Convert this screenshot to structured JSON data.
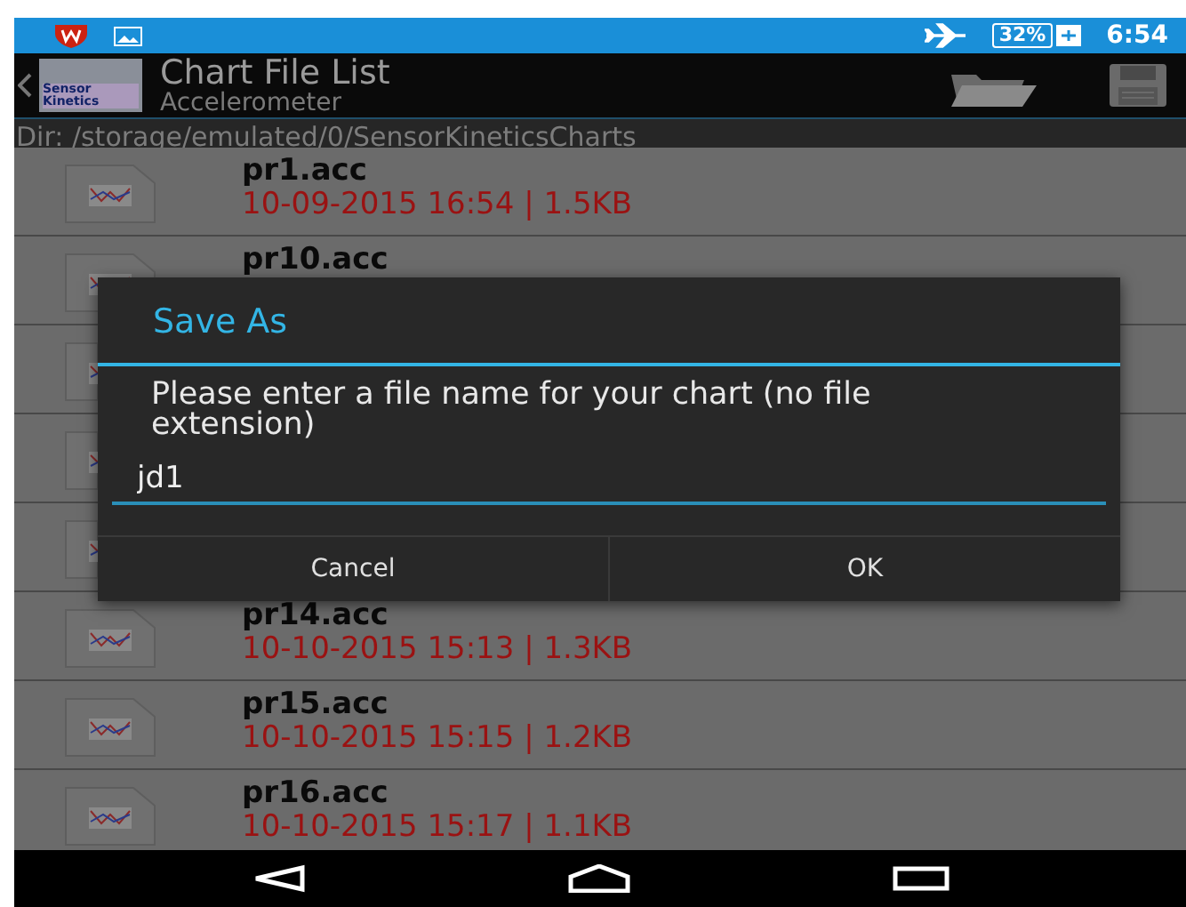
{
  "status_bar": {
    "battery": "32%",
    "time": "6:54"
  },
  "action_bar": {
    "logo_text": [
      "Sensor",
      "Kinetics"
    ],
    "title": "Chart File List",
    "subtitle": "Accelerometer"
  },
  "directory": "Dir: /storage/emulated/0/SensorKineticsCharts",
  "files": [
    {
      "kind": "file",
      "name": "pr1.acc",
      "info": "10-09-2015 16:54 | 1.5KB"
    },
    {
      "kind": "file",
      "name": "pr10.acc"
    },
    {
      "kind": "covered"
    },
    {
      "kind": "covered"
    },
    {
      "kind": "covered"
    },
    {
      "kind": "file",
      "name": "pr14.acc",
      "info": "10-10-2015 15:13 | 1.3KB"
    },
    {
      "kind": "file",
      "name": "pr15.acc",
      "info": "10-10-2015 15:15 | 1.2KB"
    },
    {
      "kind": "file",
      "name": "pr16.acc",
      "info": "10-10-2015 15:17 | 1.1KB"
    }
  ],
  "dialog": {
    "title": "Save As",
    "message": "Please enter a file name for your chart (no file extension)",
    "value": "jd1",
    "buttons": [
      "Cancel",
      "OK"
    ]
  }
}
